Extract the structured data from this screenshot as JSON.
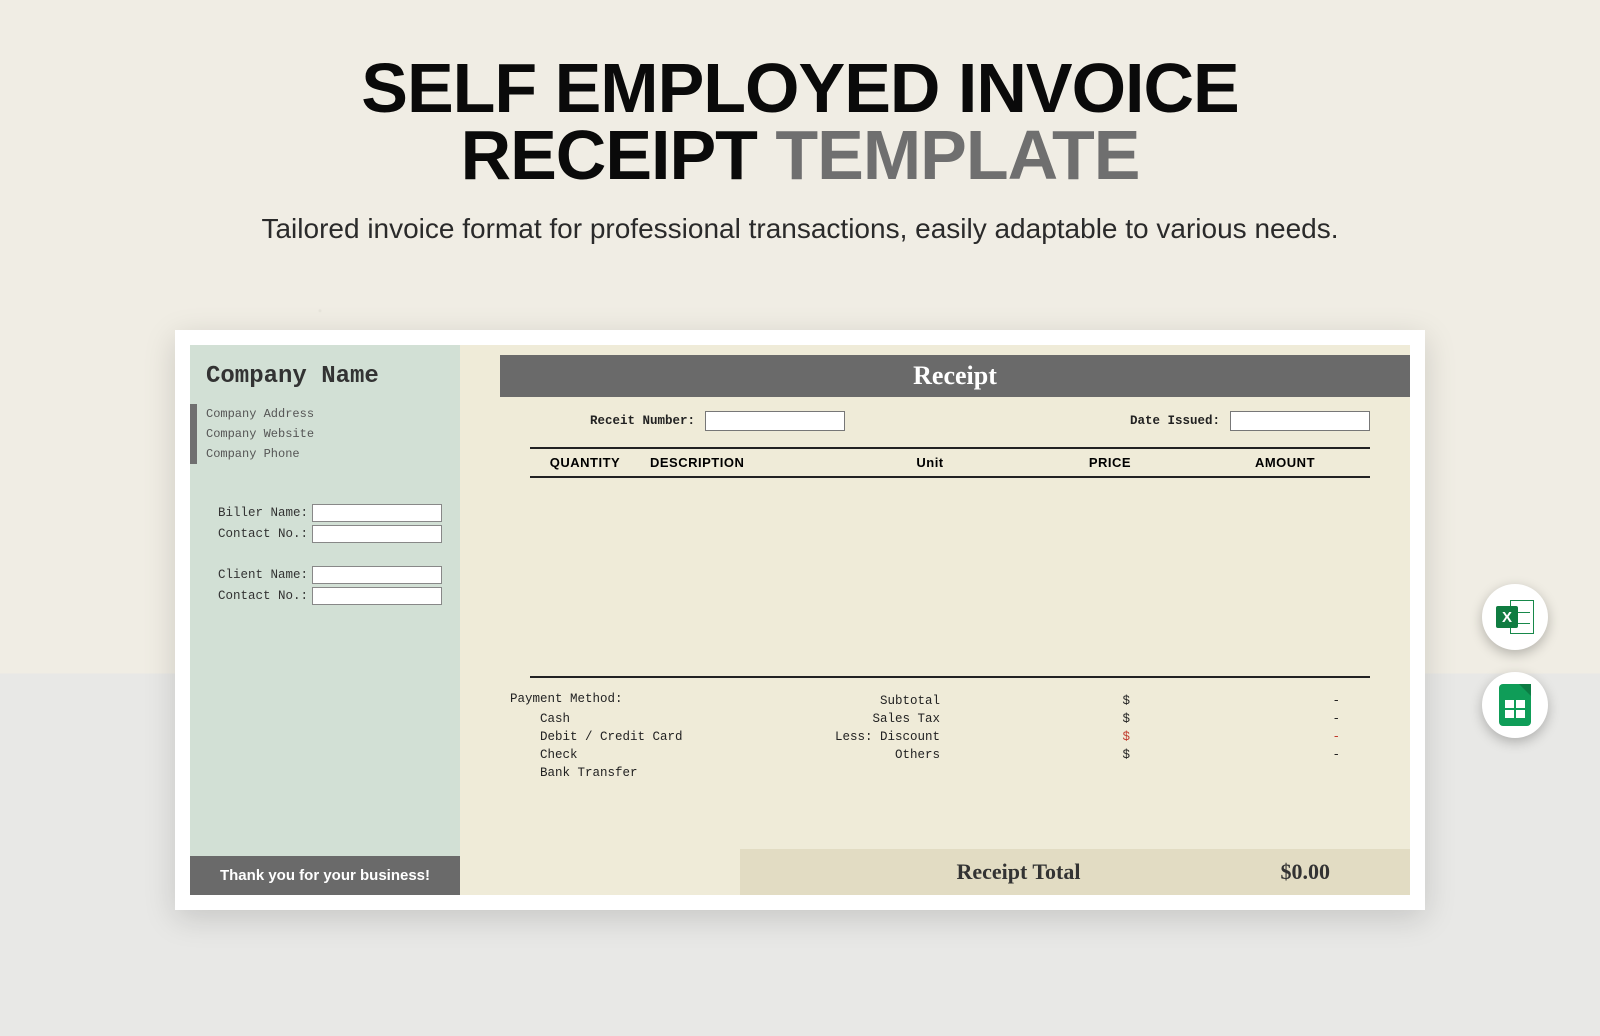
{
  "header": {
    "title_line1": "SELF EMPLOYED INVOICE",
    "title_line2_black": "RECEIPT",
    "title_line2_gray": "TEMPLATE",
    "subtitle": "Tailored invoice format for professional transactions, easily adaptable to various needs."
  },
  "receipt": {
    "company": {
      "name": "Company Name",
      "address": "Company Address",
      "website": "Company Website",
      "phone": "Company Phone"
    },
    "biller": {
      "name_label": "Biller Name:",
      "contact_label": "Contact No.:"
    },
    "client": {
      "name_label": "Client Name:",
      "contact_label": "Contact No.:"
    },
    "thanks": "Thank you for your business!",
    "banner": "Receipt",
    "meta": {
      "number_label": "Receit Number:",
      "date_label": "Date Issued:"
    },
    "columns": {
      "quantity": "QUANTITY",
      "description": "DESCRIPTION",
      "unit": "Unit",
      "price": "PRICE",
      "amount": "AMOUNT"
    },
    "payment": {
      "title": "Payment Method:",
      "methods": [
        "Cash",
        "Debit / Credit Card",
        "Check",
        "Bank Transfer"
      ]
    },
    "summary": {
      "rows": [
        {
          "label": "Subtotal",
          "currency": "$",
          "value": "-",
          "red": false
        },
        {
          "label": "Sales Tax",
          "currency": "$",
          "value": "-",
          "red": false
        },
        {
          "label": "Less: Discount",
          "currency": "$",
          "value": "-",
          "red": true
        },
        {
          "label": "Others",
          "currency": "$",
          "value": "-",
          "red": false
        }
      ]
    },
    "total": {
      "label": "Receipt Total",
      "value": "$0.00"
    }
  },
  "badges": {
    "excel": "Excel",
    "sheets": "Google Sheets"
  }
}
